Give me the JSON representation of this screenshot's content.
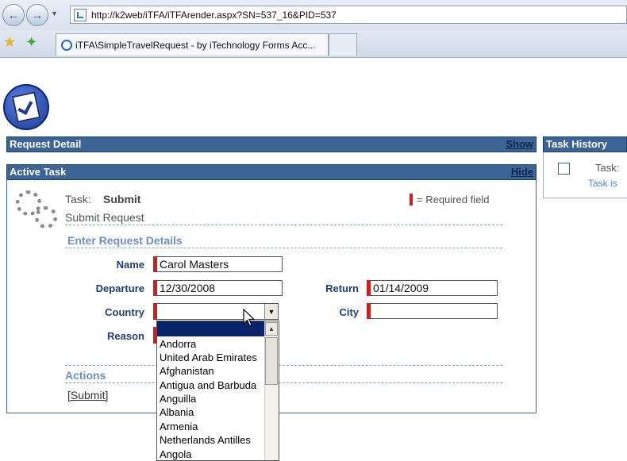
{
  "browser": {
    "address": "http://k2web/iTFA/iTFArender.aspx?SN=537_16&PID=537",
    "tab_title": "iTFA\\SimpleTravelRequest - by iTechnology Forms Acc..."
  },
  "panels": {
    "request_detail": {
      "title": "Request Detail",
      "link": "Show"
    },
    "task_history": {
      "title": "Task History",
      "task_label": "Task:",
      "task_status": "Task is"
    },
    "active_task": {
      "title": "Active Task",
      "link": "Hide"
    }
  },
  "task": {
    "label": "Task:",
    "name": "Submit",
    "description": "Submit Request",
    "required_legend": "= Required field"
  },
  "form": {
    "section_title": "Enter Request Details",
    "name_label": "Name",
    "name_value": "Carol Masters",
    "departure_label": "Departure",
    "departure_value": "12/30/2008",
    "return_label": "Return",
    "return_value": "01/14/2009",
    "country_label": "Country",
    "country_value": "",
    "city_label": "City",
    "city_value": "",
    "reason_label": "Reason"
  },
  "country_options": [
    "",
    "Andorra",
    "United Arab Emirates",
    "Afghanistan",
    "Antigua and Barbuda",
    "Anguilla",
    "Albania",
    "Armenia",
    "Netherlands Antilles",
    "Angola"
  ],
  "actions": {
    "title": "Actions",
    "submit": "[Submit]"
  },
  "colors": {
    "header_bg": "#3c6494",
    "required_mark": "#cc1f1f",
    "label_text": "#1e3e73",
    "section_text": "#6e90c2",
    "list_highlight": "#0a246a"
  }
}
